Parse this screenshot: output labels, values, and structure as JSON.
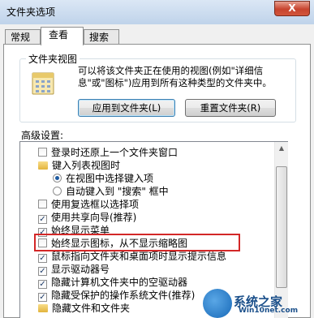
{
  "window": {
    "title": "文件夹选项",
    "close_glyph": "X"
  },
  "tabs": [
    {
      "label": "常规",
      "active": false
    },
    {
      "label": "查看",
      "active": true
    },
    {
      "label": "搜索",
      "active": false
    }
  ],
  "folder_views": {
    "group_label": "文件夹视图",
    "icon": "folder-views-icon",
    "description": "可以将该文件夹正在使用的视图(例如\"详细信息\"或\"图标\")应用到所有这种类型的文件夹中。",
    "apply_button": "应用到文件夹(L)",
    "reset_button": "重置文件夹(R)"
  },
  "advanced": {
    "label": "高级设置:",
    "items": [
      {
        "type": "checkbox",
        "checked": false,
        "indent": 0,
        "label": "登录时还原上一个文件夹窗口"
      },
      {
        "type": "folder",
        "indent": 0,
        "label": "键入列表视图时"
      },
      {
        "type": "radio",
        "checked": true,
        "indent": 1,
        "label": "在视图中选择键入项"
      },
      {
        "type": "radio",
        "checked": false,
        "indent": 1,
        "label": "自动键入到 \"搜索\" 框中"
      },
      {
        "type": "checkbox",
        "checked": false,
        "indent": 0,
        "label": "使用复选框以选择项"
      },
      {
        "type": "checkbox",
        "checked": true,
        "indent": 0,
        "label": "使用共享向导(推荐)"
      },
      {
        "type": "checkbox",
        "checked": true,
        "indent": 0,
        "label": "始终显示菜单"
      },
      {
        "type": "checkbox",
        "checked": false,
        "indent": 0,
        "label": "始终显示图标，从不显示缩略图"
      },
      {
        "type": "checkbox",
        "checked": true,
        "indent": 0,
        "label": "鼠标指向文件夹和桌面项时显示提示信息"
      },
      {
        "type": "checkbox",
        "checked": true,
        "indent": 0,
        "label": "显示驱动器号"
      },
      {
        "type": "checkbox",
        "checked": true,
        "indent": 0,
        "label": "隐藏计算机文件夹中的空驱动器"
      },
      {
        "type": "checkbox",
        "checked": true,
        "indent": 0,
        "label": "隐藏受保护的操作系统文件(推荐)"
      },
      {
        "type": "folder",
        "indent": 0,
        "label": "隐藏文件和文件夹"
      }
    ]
  },
  "watermark": {
    "line1": "系统之家",
    "line2": "Win10net.com"
  },
  "colors": {
    "highlight_border": "#d32727",
    "accent": "#1e5aa0"
  }
}
